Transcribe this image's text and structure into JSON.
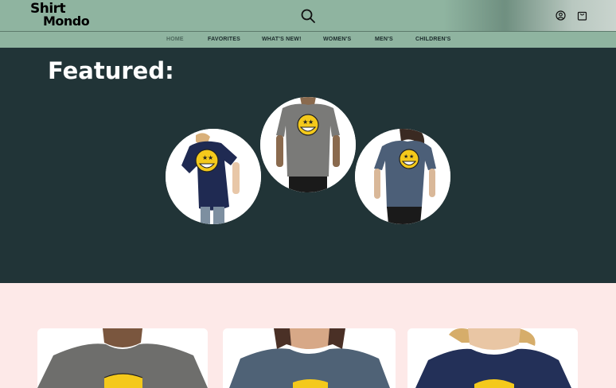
{
  "brand": {
    "line1": "Shirt",
    "line2": "Mondo"
  },
  "icons": {
    "search": "search-icon",
    "account": "user-circle-icon",
    "cart": "shopping-bag-icon"
  },
  "nav": {
    "items": [
      {
        "label": "HOME"
      },
      {
        "label": "FAVORITES"
      },
      {
        "label": "WHAT'S NEW!"
      },
      {
        "label": "WOMEN'S"
      },
      {
        "label": "MEN'S"
      },
      {
        "label": "CHILDREN'S"
      }
    ]
  },
  "featured": {
    "title": "Featured:",
    "items": [
      {
        "shirt_color": "#1f2a52",
        "image": "kid-navy-tshirt-smiley"
      },
      {
        "shirt_color": "#7a7a78",
        "image": "man-gray-tshirt-smiley"
      },
      {
        "shirt_color": "#4c5f78",
        "image": "woman-slate-tshirt-smiley"
      }
    ]
  },
  "products": {
    "items": [
      {
        "shirt_color": "#6e6e6c",
        "image": "man-gray-tshirt-smiley"
      },
      {
        "shirt_color": "#4f6276",
        "image": "woman-slate-tshirt-smiley"
      },
      {
        "shirt_color": "#233058",
        "image": "kid-navy-tshirt-smiley"
      }
    ]
  },
  "colors": {
    "header": "#8fb4a0",
    "featured_bg": "#213437",
    "products_bg": "#fde9e8",
    "smiley": "#f4c91b"
  }
}
